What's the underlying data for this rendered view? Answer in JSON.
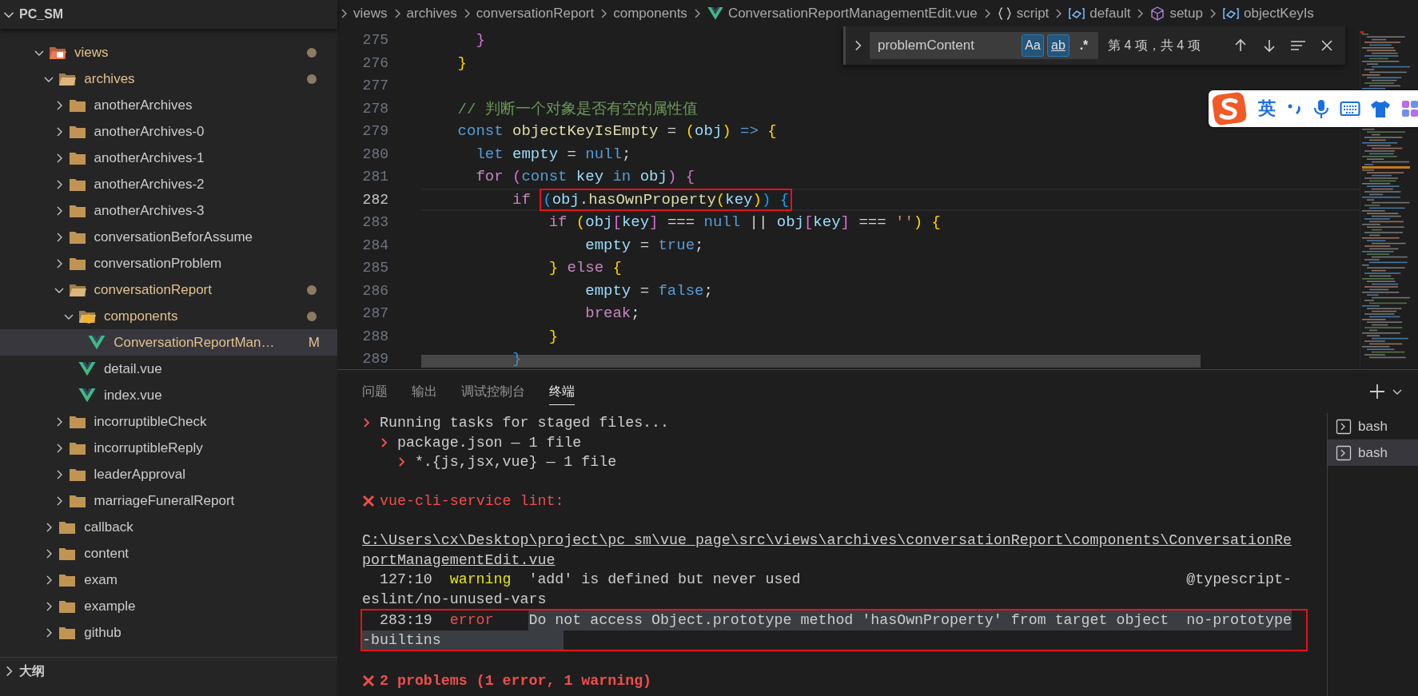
{
  "explorer": {
    "root": "PC_SM",
    "expanded": true,
    "tree": [
      {
        "name": "views",
        "kind": "views-folder",
        "expanded": true,
        "modified": true,
        "selected": false,
        "children": [
          {
            "name": "archives",
            "kind": "folder",
            "expanded": true,
            "modified": true,
            "selected": false,
            "children": [
              {
                "name": "anotherArchives",
                "kind": "folder",
                "expanded": false,
                "modified": false,
                "selected": false
              },
              {
                "name": "anotherArchives-0",
                "kind": "folder",
                "expanded": false,
                "modified": false,
                "selected": false
              },
              {
                "name": "anotherArchives-1",
                "kind": "folder",
                "expanded": false,
                "modified": false,
                "selected": false
              },
              {
                "name": "anotherArchives-2",
                "kind": "folder",
                "expanded": false,
                "modified": false,
                "selected": false
              },
              {
                "name": "anotherArchives-3",
                "kind": "folder",
                "expanded": false,
                "modified": false,
                "selected": false
              },
              {
                "name": "conversationBeforAssume",
                "kind": "folder",
                "expanded": false,
                "modified": false,
                "selected": false
              },
              {
                "name": "conversationProblem",
                "kind": "folder",
                "expanded": false,
                "modified": false,
                "selected": false
              },
              {
                "name": "conversationReport",
                "kind": "folder",
                "expanded": true,
                "modified": true,
                "selected": false,
                "children": [
                  {
                    "name": "components",
                    "kind": "components-folder",
                    "expanded": true,
                    "modified": true,
                    "selected": false,
                    "children": [
                      {
                        "name": "ConversationReportMan…",
                        "kind": "vue-file",
                        "modified": true,
                        "badge": "M",
                        "selected": true
                      }
                    ]
                  },
                  {
                    "name": "detail.vue",
                    "kind": "vue-file",
                    "modified": false,
                    "selected": false
                  },
                  {
                    "name": "index.vue",
                    "kind": "vue-file",
                    "modified": false,
                    "selected": false
                  }
                ]
              },
              {
                "name": "incorruptibleCheck",
                "kind": "folder",
                "expanded": false,
                "modified": false,
                "selected": false
              },
              {
                "name": "incorruptibleReply",
                "kind": "folder",
                "expanded": false,
                "modified": false,
                "selected": false
              },
              {
                "name": "leaderApproval",
                "kind": "folder",
                "expanded": false,
                "modified": false,
                "selected": false
              },
              {
                "name": "marriageFuneralReport",
                "kind": "folder",
                "expanded": false,
                "modified": false,
                "selected": false
              }
            ]
          },
          {
            "name": "callback",
            "kind": "folder",
            "expanded": false,
            "modified": false,
            "selected": false
          },
          {
            "name": "content",
            "kind": "folder",
            "expanded": false,
            "modified": false,
            "selected": false
          },
          {
            "name": "exam",
            "kind": "folder",
            "expanded": false,
            "modified": false,
            "selected": false
          },
          {
            "name": "example",
            "kind": "folder",
            "expanded": false,
            "modified": false,
            "selected": false
          },
          {
            "name": "github",
            "kind": "folder",
            "expanded": false,
            "modified": false,
            "selected": false
          }
        ]
      }
    ]
  },
  "outline": {
    "title": "大纲",
    "expanded": false
  },
  "breadcrumb": [
    {
      "label": "views",
      "kind": "folder"
    },
    {
      "label": "archives",
      "kind": "folder"
    },
    {
      "label": "conversationReport",
      "kind": "folder"
    },
    {
      "label": "components",
      "kind": "folder"
    },
    {
      "label": "ConversationReportManagementEdit.vue",
      "kind": "vue-file"
    },
    {
      "label": "script",
      "kind": "braces"
    },
    {
      "label": "default",
      "kind": "variable"
    },
    {
      "label": "setup",
      "kind": "module"
    },
    {
      "label": "objectKeyIs",
      "kind": "variable"
    }
  ],
  "code": [
    {
      "number": "275",
      "current": false,
      "tokens": [
        {
          "text": "      }",
          "kind": "bracket2"
        }
      ]
    },
    {
      "number": "276",
      "current": false,
      "tokens": [
        {
          "text": "    }",
          "kind": "bracket1"
        }
      ]
    },
    {
      "number": "277",
      "current": false
    },
    {
      "number": "278",
      "current": false,
      "tokens": [
        {
          "text": "    // 判断一个对象是否有空的属性值",
          "kind": "comment"
        }
      ]
    },
    {
      "number": "279",
      "current": false,
      "tokens": [
        {
          "text": "    const",
          "kind": "keyword"
        },
        {
          "text": " objectKeyIsEmpty",
          "kind": "function"
        },
        {
          "text": " = ",
          "kind": "plain"
        },
        {
          "text": "(",
          "kind": "bracket1"
        },
        {
          "text": "obj",
          "kind": "variable"
        },
        {
          "text": ")",
          "kind": "bracket1"
        },
        {
          "text": " => ",
          "kind": "keyword"
        },
        {
          "text": "{",
          "kind": "bracket1"
        }
      ]
    },
    {
      "number": "280",
      "current": false,
      "tokens": [
        {
          "text": "      let",
          "kind": "keyword"
        },
        {
          "text": " empty",
          "kind": "variable"
        },
        {
          "text": " = ",
          "kind": "plain"
        },
        {
          "text": "null",
          "kind": "keyword"
        },
        {
          "text": ";",
          "kind": "plain"
        }
      ]
    },
    {
      "number": "281",
      "current": false,
      "tokens": [
        {
          "text": "      for",
          "kind": "control"
        },
        {
          "text": " (",
          "kind": "bracket2"
        },
        {
          "text": "const",
          "kind": "keyword"
        },
        {
          "text": " key",
          "kind": "variable"
        },
        {
          "text": " in",
          "kind": "keyword"
        },
        {
          "text": " obj",
          "kind": "variable"
        },
        {
          "text": ") {",
          "kind": "bracket2"
        }
      ]
    },
    {
      "number": "282",
      "current": true,
      "tokens": [
        {
          "text": "          if ",
          "kind": "control"
        },
        {
          "kind": "annotation",
          "children": [
            {
              "text": "(",
              "kind": "bracket3"
            },
            {
              "text": "obj",
              "kind": "variable"
            },
            {
              "text": ".",
              "kind": "plain"
            },
            {
              "text": "hasOwnProperty",
              "kind": "function"
            },
            {
              "text": "(",
              "kind": "bracket1"
            },
            {
              "text": "key",
              "kind": "variable"
            },
            {
              "text": ")",
              "kind": "bracket1"
            },
            {
              "text": ") {",
              "kind": "bracket3"
            }
          ]
        }
      ]
    },
    {
      "number": "283",
      "current": false,
      "tokens": [
        {
          "text": "              if",
          "kind": "control"
        },
        {
          "text": " (",
          "kind": "bracket1"
        },
        {
          "text": "obj",
          "kind": "variable"
        },
        {
          "text": "[",
          "kind": "bracket2"
        },
        {
          "text": "key",
          "kind": "variable"
        },
        {
          "text": "]",
          "kind": "bracket2"
        },
        {
          "text": " === ",
          "kind": "plain"
        },
        {
          "text": "null",
          "kind": "keyword"
        },
        {
          "text": " || ",
          "kind": "plain"
        },
        {
          "text": "obj",
          "kind": "variable"
        },
        {
          "text": "[",
          "kind": "bracket2"
        },
        {
          "text": "key",
          "kind": "variable"
        },
        {
          "text": "]",
          "kind": "bracket2"
        },
        {
          "text": " === ",
          "kind": "plain"
        },
        {
          "text": "''",
          "kind": "string"
        },
        {
          "text": ") {",
          "kind": "bracket1"
        }
      ]
    },
    {
      "number": "284",
      "current": false,
      "tokens": [
        {
          "text": "                  empty",
          "kind": "variable"
        },
        {
          "text": " = ",
          "kind": "plain"
        },
        {
          "text": "true",
          "kind": "keyword"
        },
        {
          "text": ";",
          "kind": "plain"
        }
      ]
    },
    {
      "number": "285",
      "current": false,
      "tokens": [
        {
          "text": "              }",
          "kind": "bracket1"
        },
        {
          "text": " else ",
          "kind": "control"
        },
        {
          "text": "{",
          "kind": "bracket1"
        }
      ]
    },
    {
      "number": "286",
      "current": false,
      "tokens": [
        {
          "text": "                  empty",
          "kind": "variable"
        },
        {
          "text": " = ",
          "kind": "plain"
        },
        {
          "text": "false",
          "kind": "keyword"
        },
        {
          "text": ";",
          "kind": "plain"
        }
      ]
    },
    {
      "number": "287",
      "current": false,
      "tokens": [
        {
          "text": "                  break",
          "kind": "control"
        },
        {
          "text": ";",
          "kind": "plain"
        }
      ]
    },
    {
      "number": "288",
      "current": false,
      "tokens": [
        {
          "text": "              }",
          "kind": "bracket1"
        }
      ]
    },
    {
      "number": "289",
      "current": false,
      "tokens": [
        {
          "text": "          }",
          "kind": "bracket3"
        }
      ]
    }
  ],
  "find": {
    "expanded": false,
    "query": "problemContent",
    "options": [
      {
        "label": "Aa",
        "kind": "case",
        "on": true
      },
      {
        "label": "ab",
        "kind": "word",
        "on": true
      },
      {
        "label": ".*",
        "kind": "regex",
        "on": false
      }
    ],
    "matches": "第 4 项，共 4 项"
  },
  "ime": {
    "mode": "英"
  },
  "panel": {
    "tabs": [
      {
        "label": "问题",
        "selected": false
      },
      {
        "label": "输出",
        "selected": false
      },
      {
        "label": "调试控制台",
        "selected": false
      },
      {
        "label": "终端",
        "selected": true
      }
    ],
    "terminal": [
      {
        "kind": "task",
        "text": "Running tasks for staged files...",
        "children": [
          {
            "kind": "task",
            "text": "package.json — 1 file",
            "children": [
              {
                "kind": "task",
                "text": "*.{js,jsx,vue} — 1 file"
              }
            ]
          }
        ]
      },
      {
        "kind": "blank"
      },
      {
        "kind": "failure",
        "text": "vue-cli-service lint:"
      },
      {
        "kind": "blank"
      },
      {
        "kind": "path",
        "text": "C:\\Users\\cx\\Desktop\\project\\pc_sm\\vue_page\\src\\views\\archives\\conversationReport\\components\\ConversationRe"
      },
      {
        "kind": "path",
        "text": "portManagementEdit.vue"
      },
      {
        "kind": "problem",
        "position": "127:10",
        "severity": "warning",
        "message": "'add' is defined but never used",
        "rule": "@typescript-",
        "rule_rest": "eslint/no-unused-vars",
        "selected": false,
        "boxed": false
      },
      {
        "kind": "problem",
        "position": "283:19",
        "severity": "error",
        "message": "Do not access Object.prototype method 'hasOwnProperty' from target object",
        "rule": "no-prototype",
        "rule_rest": "-builtins",
        "selected": true,
        "boxed": true
      },
      {
        "kind": "blank"
      },
      {
        "kind": "summary",
        "text": "2 problems (1 error, 1 warning)"
      }
    ],
    "sessions": [
      {
        "label": "bash",
        "selected": false
      },
      {
        "label": "bash",
        "selected": true
      }
    ]
  }
}
